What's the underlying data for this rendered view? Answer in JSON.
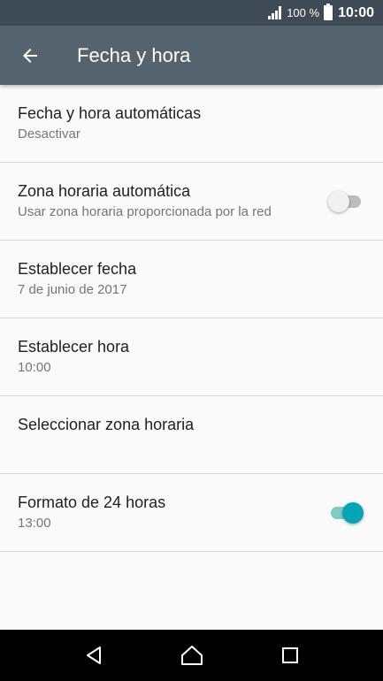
{
  "status_bar": {
    "battery_percent": "100 %",
    "time": "10:00",
    "icons": [
      "signal-icon",
      "battery-icon"
    ]
  },
  "app_bar": {
    "title": "Fecha y hora",
    "back_icon": "arrow-back-icon"
  },
  "settings": [
    {
      "title": "Fecha y hora automáticas",
      "summary": "Desactivar"
    },
    {
      "title": "Zona horaria automática",
      "summary": "Usar zona horaria proporcionada por la red",
      "toggle": "off"
    },
    {
      "title": "Establecer fecha",
      "summary": "7 de junio de 2017"
    },
    {
      "title": "Establecer hora",
      "summary": "10:00"
    },
    {
      "title": "Seleccionar zona horaria",
      "summary": ""
    },
    {
      "title": "Formato de 24 horas",
      "summary": "13:00",
      "toggle": "on"
    }
  ],
  "nav_bar": {
    "icons": [
      "nav-back-icon",
      "nav-home-icon",
      "nav-recents-icon"
    ]
  },
  "colors": {
    "status_bar": "#3e4b56",
    "app_bar": "#54636e",
    "background": "#fafafa",
    "accent": "#00a5b8"
  }
}
